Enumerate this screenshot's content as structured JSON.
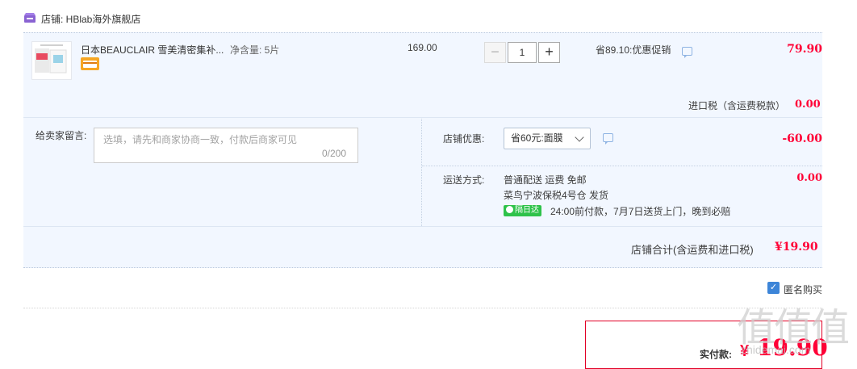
{
  "shop": {
    "label": "店铺: HBlab海外旗舰店",
    "icon": "shop-icon"
  },
  "item": {
    "name": "日本BEAUCLAIR 雪美清密集补...",
    "spec": "净含量: 5片",
    "unit_price": "169.00",
    "quantity": "1",
    "qty_minus": "−",
    "qty_plus": "+",
    "promo": "省89.10:优惠促销",
    "total": "79.90",
    "badge_icon": "cross-border-card-icon"
  },
  "tax": {
    "label": "进口税（含运费税款）",
    "value": "0.00"
  },
  "message": {
    "label": "给卖家留言:",
    "placeholder": "选填，请先和商家协商一致，付款后商家可见",
    "counter": "0/200"
  },
  "coupon": {
    "label": "店铺优惠:",
    "selected": "省60元:面膜",
    "value": "-60.00"
  },
  "shipping": {
    "label": "运送方式:",
    "method": "普通配送 运费 免邮",
    "warehouse": "菜鸟宁波保税4号仓   发货",
    "badge": "隔日达",
    "delivery_note": "24:00前付款，7月7日送货上门，晚到必赔",
    "value": "0.00"
  },
  "subtotal": {
    "label": "店铺合计(含运费和进口税)",
    "value": "¥19.90"
  },
  "anonymous": {
    "checked": true,
    "label": "匿名购买"
  },
  "payment": {
    "label": "实付款:",
    "currency": "¥",
    "amount": "19.90"
  },
  "watermark": {
    "chars": "值值值",
    "url": "zhidemai.com"
  },
  "colors": {
    "accent_red": "#ff0036",
    "panel_bg": "#f2f7ff",
    "check_blue": "#3d85d8",
    "badge_green": "#2ec24a"
  }
}
